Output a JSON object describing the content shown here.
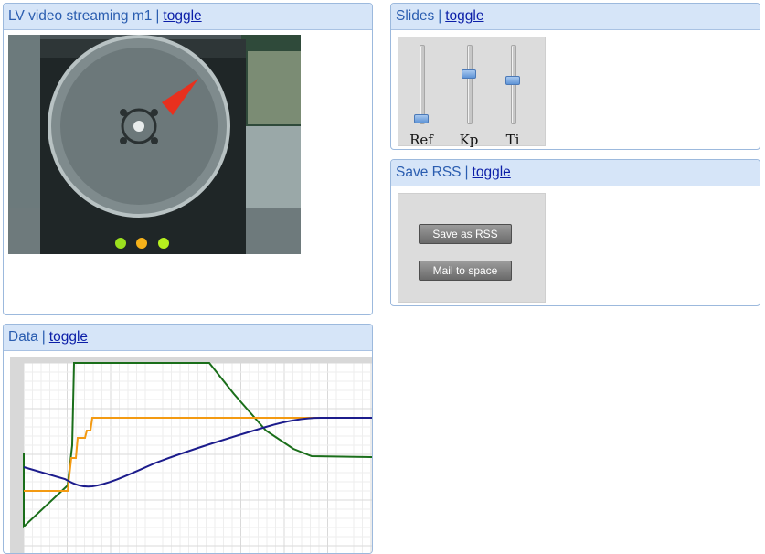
{
  "toggle_label": "toggle",
  "separator": "|",
  "video_panel": {
    "title": "LV video streaming m1"
  },
  "slides_panel": {
    "title": "Slides",
    "sliders": [
      {
        "label": "Ref",
        "level": 0.0
      },
      {
        "label": "Kp",
        "level": 0.65
      },
      {
        "label": "Ti",
        "level": 0.55
      }
    ]
  },
  "rss_panel": {
    "title": "Save RSS",
    "save_button": "Save as RSS",
    "mail_button": "Mail to space"
  },
  "data_panel": {
    "title": "Data"
  },
  "colors": {
    "green": "#1a6e1a",
    "orange": "#f39a12",
    "navy": "#1c1c8c"
  }
}
